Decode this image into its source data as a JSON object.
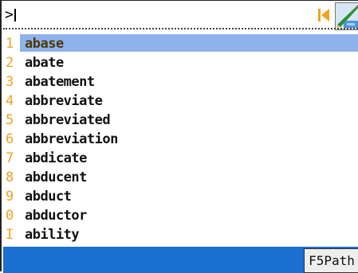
{
  "input": {
    "prompt": ">",
    "value": ""
  },
  "toolbar": {
    "first_icon": "skip-to-start-icon",
    "edit_icon": "edit-pen-icon",
    "accent_color": "#f1a220"
  },
  "list": {
    "selected_index": 0,
    "items": [
      {
        "key": "1",
        "word": "abase"
      },
      {
        "key": "2",
        "word": "abate"
      },
      {
        "key": "3",
        "word": "abatement"
      },
      {
        "key": "4",
        "word": "abbreviate"
      },
      {
        "key": "5",
        "word": "abbreviated"
      },
      {
        "key": "6",
        "word": "abbreviation"
      },
      {
        "key": "7",
        "word": "abdicate"
      },
      {
        "key": "8",
        "word": "abducent"
      },
      {
        "key": "9",
        "word": "abduct"
      },
      {
        "key": "0",
        "word": "abductor"
      },
      {
        "key": "I",
        "word": "ability"
      }
    ],
    "highlight_color": "#8fb2ec"
  },
  "status_bar": {
    "color": "#1a6fd1",
    "f5_label": "F5Path"
  }
}
